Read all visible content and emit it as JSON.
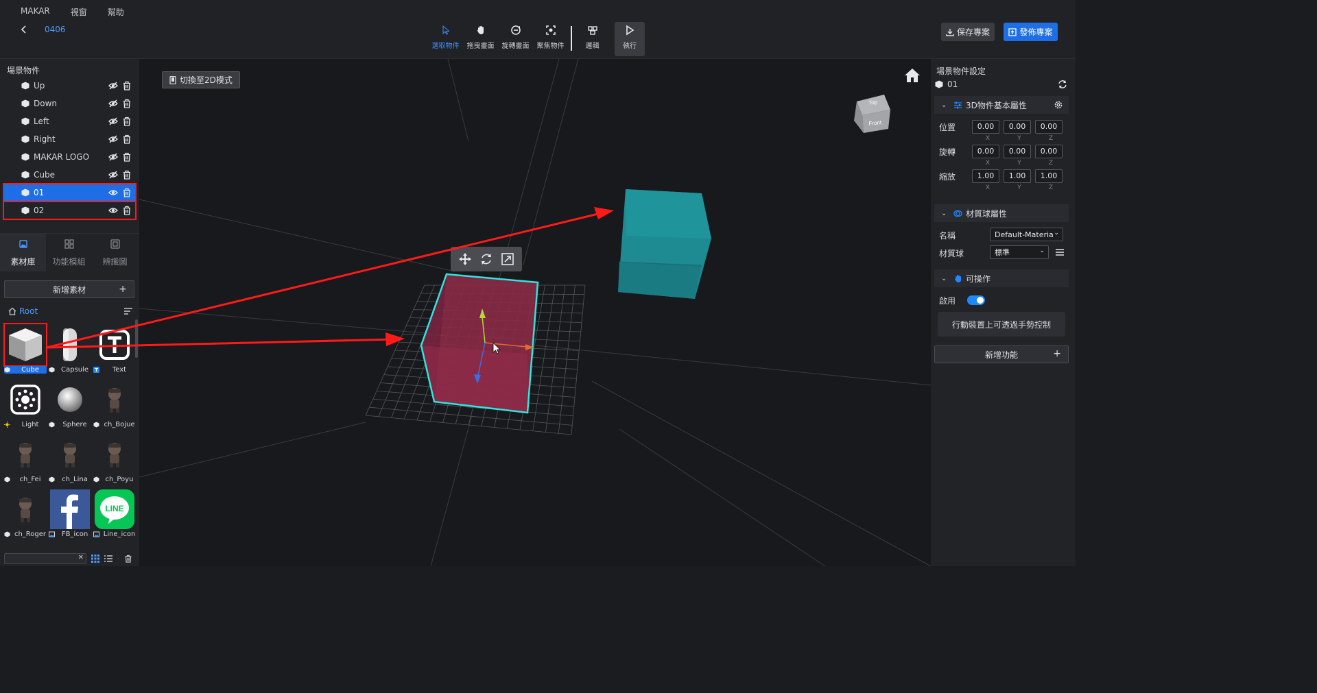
{
  "menu": [
    "MAKAR",
    "視窗",
    "幫助"
  ],
  "project": {
    "name": "0406"
  },
  "toolbar": {
    "select": "選取物件",
    "pan": "拖曳畫面",
    "rotate": "旋轉畫面",
    "focus": "聚焦物件",
    "logic": "邏輯",
    "run": "執行",
    "save": "保存專案",
    "publish": "發佈專案"
  },
  "scene": {
    "title": "場景物件",
    "objects": [
      {
        "name": "Up",
        "visible": false
      },
      {
        "name": "Down",
        "visible": false
      },
      {
        "name": "Left",
        "visible": false
      },
      {
        "name": "Right",
        "visible": false
      },
      {
        "name": "MAKAR LOGO",
        "visible": false
      },
      {
        "name": "Cube",
        "visible": false
      },
      {
        "name": "01",
        "visible": true,
        "selected": true
      },
      {
        "name": "02",
        "visible": true
      }
    ]
  },
  "library": {
    "tabs": [
      "素材庫",
      "功能模組",
      "辨識圖"
    ],
    "active_tab": "素材庫",
    "add_label": "新增素材",
    "root_label": "Root",
    "assets": [
      {
        "name": "Cube",
        "icon": "cube",
        "selected": true
      },
      {
        "name": "Capsule",
        "icon": "capsule"
      },
      {
        "name": "Text",
        "icon": "text"
      },
      {
        "name": "Light",
        "icon": "light"
      },
      {
        "name": "Sphere",
        "icon": "sphere"
      },
      {
        "name": "ch_Bojue",
        "icon": "character"
      },
      {
        "name": "ch_Fei",
        "icon": "character"
      },
      {
        "name": "ch_Lina",
        "icon": "character"
      },
      {
        "name": "ch_Poyu",
        "icon": "character"
      },
      {
        "name": "ch_Roger",
        "icon": "character"
      },
      {
        "name": "FB_icon",
        "icon": "facebook"
      },
      {
        "name": "Line_icon",
        "icon": "line"
      }
    ]
  },
  "viewport": {
    "mode_button": "切換至2D模式",
    "gizmo": {
      "top": "Top",
      "front": "Front"
    }
  },
  "inspector": {
    "title": "場景物件設定",
    "object_name": "01",
    "transform": {
      "title": "3D物件基本屬性",
      "axes": [
        "X",
        "Y",
        "Z"
      ],
      "rows": [
        {
          "label": "位置",
          "values": [
            "0.00",
            "0.00",
            "0.00"
          ]
        },
        {
          "label": "旋轉",
          "values": [
            "0.00",
            "0.00",
            "0.00"
          ]
        },
        {
          "label": "縮放",
          "values": [
            "1.00",
            "1.00",
            "1.00"
          ]
        }
      ]
    },
    "material": {
      "title": "材質球屬性",
      "name_label": "名稱",
      "name_value": "Default-Materia",
      "ball_label": "材質球",
      "ball_value": "標準"
    },
    "interactive": {
      "title": "可操作",
      "enable_label": "啟用",
      "enabled": true,
      "hint": "行動裝置上可透過手勢控制"
    },
    "add_function": "新增功能"
  },
  "colors": {
    "accent": "#1e6fe6",
    "highlight": "#ff1a1a",
    "selected_cube": "#8a2a47",
    "teal_cube": "#1e8a92",
    "selection_outline": "#2ee6e0"
  }
}
